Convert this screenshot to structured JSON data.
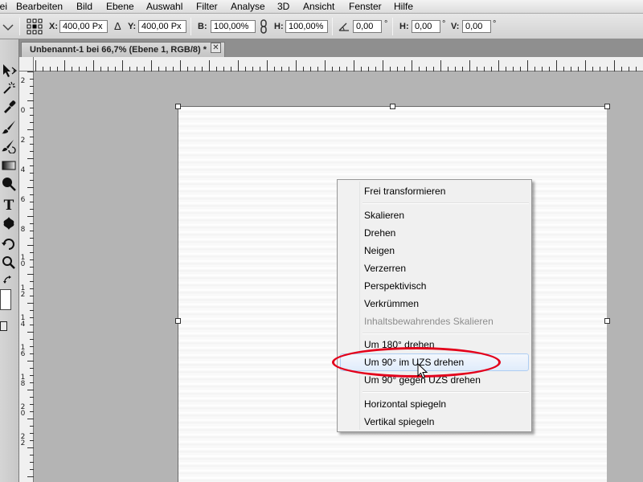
{
  "menubar": {
    "items": [
      "Datei",
      "Bearbeiten",
      "Bild",
      "Ebene",
      "Auswahl",
      "Filter",
      "Analyse",
      "3D",
      "Ansicht",
      "Fenster",
      "Hilfe"
    ]
  },
  "options": {
    "x_label": "X:",
    "x_value": "400,00 Px",
    "delta_symbol": "Δ",
    "y_label": "Y:",
    "y_value": "400,00 Px",
    "w_label": "B:",
    "w_value": "100,00%",
    "h_label": "H:",
    "h_value": "100,00%",
    "angle_value": "0,00",
    "angle_unit": "°",
    "hskew_label": "H:",
    "hskew_value": "0,00",
    "hskew_unit": "°",
    "vskew_label": "V:",
    "vskew_value": "0,00",
    "vskew_unit": "°"
  },
  "document": {
    "tab_title": "Unbenannt-1 bei 66,7% (Ebene 1, RGB/8) *",
    "close_glyph": "✕"
  },
  "rulers": {
    "left_numbers": [
      "2",
      "0",
      "2",
      "4",
      "6",
      "8",
      "1 0",
      "1 2",
      "1 4",
      "1 6",
      "1 8",
      "2 0",
      "2 2"
    ]
  },
  "context_menu": {
    "items": [
      "Frei transformieren",
      "Skalieren",
      "Drehen",
      "Neigen",
      "Verzerren",
      "Perspektivisch",
      "Verkrümmen",
      "Inhaltsbewahrendes Skalieren",
      "Um 180° drehen",
      "Um 90° im UZS drehen",
      "Um 90° gegen UZS drehen",
      "Horizontal spiegeln",
      "Vertikal spiegeln"
    ],
    "disabled_item": "Inhaltsbewahrendes Skalieren",
    "highlighted_item": "Um 90° im UZS drehen",
    "highlight_color": "#e3001b"
  },
  "tools": {
    "icons": [
      "move-tool-icon",
      "magic-wand-tool-icon",
      "eyedropper-tool-icon",
      "brush-tool-icon",
      "history-brush-tool-icon",
      "gradient-tool-icon",
      "dodge-tool-icon",
      "type-tool-icon",
      "custom-shape-tool-icon",
      "rotate-view-tool-icon",
      "zoom-tool-icon",
      "swap-colors-icon"
    ]
  }
}
